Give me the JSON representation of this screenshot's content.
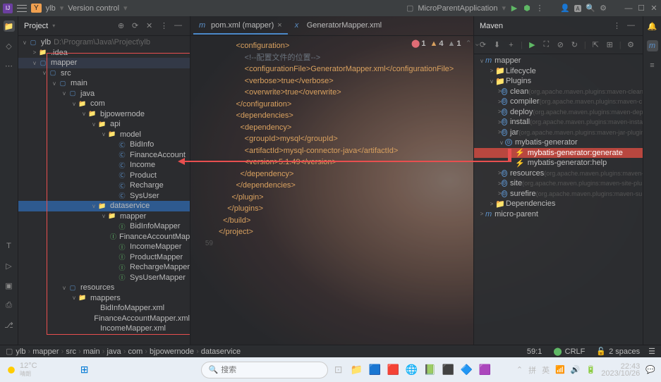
{
  "titlebar": {
    "badge": "Y",
    "proj": "ylb",
    "vc": "Version control",
    "run_cfg": "MicroParentApplication"
  },
  "project": {
    "title": "Project",
    "root": "ylb",
    "root_path": "D:\\Program\\Java\\Project\\ylb",
    "items": [
      {
        "d": 1,
        "a": ">",
        "ic": "fld",
        "t": ".idea"
      },
      {
        "d": 1,
        "a": "v",
        "ic": "fldb",
        "t": "mapper",
        "hl": 1
      },
      {
        "d": 2,
        "a": "v",
        "ic": "fldb",
        "t": "src"
      },
      {
        "d": 3,
        "a": "v",
        "ic": "fldb",
        "t": "main"
      },
      {
        "d": 4,
        "a": "v",
        "ic": "fldb",
        "t": "java"
      },
      {
        "d": 5,
        "a": "v",
        "ic": "fld",
        "t": "com"
      },
      {
        "d": 6,
        "a": "v",
        "ic": "fld",
        "t": "bjpowernode"
      },
      {
        "d": 7,
        "a": "v",
        "ic": "fld",
        "t": "api"
      },
      {
        "d": 8,
        "a": "v",
        "ic": "fld",
        "t": "model"
      },
      {
        "d": 9,
        "a": "",
        "ic": "cls",
        "t": "BidInfo"
      },
      {
        "d": 9,
        "a": "",
        "ic": "cls",
        "t": "FinanceAccount"
      },
      {
        "d": 9,
        "a": "",
        "ic": "cls",
        "t": "Income"
      },
      {
        "d": 9,
        "a": "",
        "ic": "cls",
        "t": "Product"
      },
      {
        "d": 9,
        "a": "",
        "ic": "cls",
        "t": "Recharge"
      },
      {
        "d": 9,
        "a": "",
        "ic": "cls",
        "t": "SysUser"
      },
      {
        "d": 7,
        "a": "v",
        "ic": "fld",
        "t": "dataservice",
        "sel": 1
      },
      {
        "d": 8,
        "a": "v",
        "ic": "fld",
        "t": "mapper"
      },
      {
        "d": 9,
        "a": "",
        "ic": "clsg",
        "t": "BidInfoMapper"
      },
      {
        "d": 9,
        "a": "",
        "ic": "clsg",
        "t": "FinanceAccountMapper"
      },
      {
        "d": 9,
        "a": "",
        "ic": "clsg",
        "t": "IncomeMapper"
      },
      {
        "d": 9,
        "a": "",
        "ic": "clsg",
        "t": "ProductMapper"
      },
      {
        "d": 9,
        "a": "",
        "ic": "clsg",
        "t": "RechargeMapper"
      },
      {
        "d": 9,
        "a": "",
        "ic": "clsg",
        "t": "SysUserMapper"
      },
      {
        "d": 4,
        "a": "v",
        "ic": "fldb",
        "t": "resources"
      },
      {
        "d": 5,
        "a": "v",
        "ic": "fld",
        "t": "mappers"
      },
      {
        "d": 6,
        "a": "",
        "ic": "xml",
        "t": "BidInfoMapper.xml"
      },
      {
        "d": 6,
        "a": "",
        "ic": "xml",
        "t": "FinanceAccountMapper.xml"
      },
      {
        "d": 6,
        "a": "",
        "ic": "xml",
        "t": "IncomeMapper.xml"
      }
    ]
  },
  "tabs": [
    {
      "ic": "m",
      "label": "pom.xml (mapper)",
      "active": true,
      "close": "×"
    },
    {
      "ic": "x",
      "label": "GeneratorMapper.xml",
      "active": false
    }
  ],
  "warnings": {
    "err": "1",
    "warn": "4",
    "weak": "1"
  },
  "code": {
    "lines": [
      {
        "n": "",
        "t": "        <configuration>",
        "cls": "tag"
      },
      {
        "n": "",
        "t": "            <!--配置文件的位置-->",
        "cls": "cmt"
      },
      {
        "n": "",
        "t": "            <configurationFile>GeneratorMapper.xml</configurationFile>",
        "cls": "tag"
      },
      {
        "n": "",
        "t": "            <verbose>true</verbose>",
        "cls": "tag"
      },
      {
        "n": "",
        "t": "            <overwrite>true</overwrite>",
        "cls": "tag"
      },
      {
        "n": "",
        "t": "        </configuration>",
        "cls": "tag"
      },
      {
        "n": "",
        "t": "",
        "cls": ""
      },
      {
        "n": "",
        "t": "        <dependencies>",
        "cls": "tag"
      },
      {
        "n": "",
        "t": "          <dependency>",
        "cls": "tag"
      },
      {
        "n": "",
        "t": "            <groupId>mysql</groupId>",
        "cls": "tag"
      },
      {
        "n": "",
        "t": "            <artifactId>mysql-connector-java</artifactId>",
        "cls": "tag"
      },
      {
        "n": "",
        "t": "            <version>5.1.49</version>",
        "cls": "tag"
      },
      {
        "n": "",
        "t": "          </dependency>",
        "cls": "tag"
      },
      {
        "n": "",
        "t": "        </dependencies>",
        "cls": "tag"
      },
      {
        "n": "",
        "t": "",
        "cls": ""
      },
      {
        "n": "",
        "t": "      </plugin>",
        "cls": "tag"
      },
      {
        "n": "",
        "t": "    </plugins>",
        "cls": "tag"
      },
      {
        "n": "",
        "t": "  </build>",
        "cls": "tag"
      },
      {
        "n": "",
        "t": "</project>",
        "cls": "tag"
      },
      {
        "n": "59",
        "t": "",
        "cls": ""
      }
    ]
  },
  "maven": {
    "title": "Maven",
    "items": [
      {
        "d": 0,
        "a": "v",
        "ic": "m",
        "t": "mapper"
      },
      {
        "d": 1,
        "a": ">",
        "ic": "f",
        "t": "Lifecycle"
      },
      {
        "d": 1,
        "a": "v",
        "ic": "f",
        "t": "Plugins"
      },
      {
        "d": 2,
        "a": ">",
        "ic": "c",
        "t": "clean",
        "dim": "(org.apache.maven.plugins:maven-clean-...)"
      },
      {
        "d": 2,
        "a": ">",
        "ic": "c",
        "t": "compiler",
        "dim": "(org.apache.maven.plugins:maven-c...)"
      },
      {
        "d": 2,
        "a": ">",
        "ic": "c",
        "t": "deploy",
        "dim": "(org.apache.maven.plugins:maven-depl...)"
      },
      {
        "d": 2,
        "a": ">",
        "ic": "c",
        "t": "install",
        "dim": "(org.apache.maven.plugins:maven-insta...)"
      },
      {
        "d": 2,
        "a": ">",
        "ic": "c",
        "t": "jar",
        "dim": "(org.apache.maven.plugins:maven-jar-plugin...)"
      },
      {
        "d": 2,
        "a": "v",
        "ic": "c",
        "t": "mybatis-generator",
        "dim": ""
      },
      {
        "d": 3,
        "a": "",
        "ic": "r",
        "t": "mybatis-generator:generate",
        "hl": 1
      },
      {
        "d": 3,
        "a": "",
        "ic": "r",
        "t": "mybatis-generator:help"
      },
      {
        "d": 2,
        "a": ">",
        "ic": "c",
        "t": "resources",
        "dim": "(org.apache.maven.plugins:maven-re...)"
      },
      {
        "d": 2,
        "a": ">",
        "ic": "c",
        "t": "site",
        "dim": "(org.apache.maven.plugins:maven-site-plu...)"
      },
      {
        "d": 2,
        "a": ">",
        "ic": "c",
        "t": "surefire",
        "dim": "(org.apache.maven.plugins:maven-su...)"
      },
      {
        "d": 1,
        "a": ">",
        "ic": "f",
        "t": "Dependencies"
      },
      {
        "d": 0,
        "a": ">",
        "ic": "m",
        "t": "micro-parent"
      }
    ]
  },
  "breadcrumb": [
    "ylb",
    "mapper",
    "src",
    "main",
    "java",
    "com",
    "bjpowernode",
    "dataservice"
  ],
  "status": {
    "pos": "59:1",
    "enc": "CRLF",
    "indent": "2 spaces"
  },
  "taskbar": {
    "temp": "12°C",
    "cond": "晴朗",
    "search": "搜索",
    "time": "22:43",
    "date": "2023/10/26"
  }
}
